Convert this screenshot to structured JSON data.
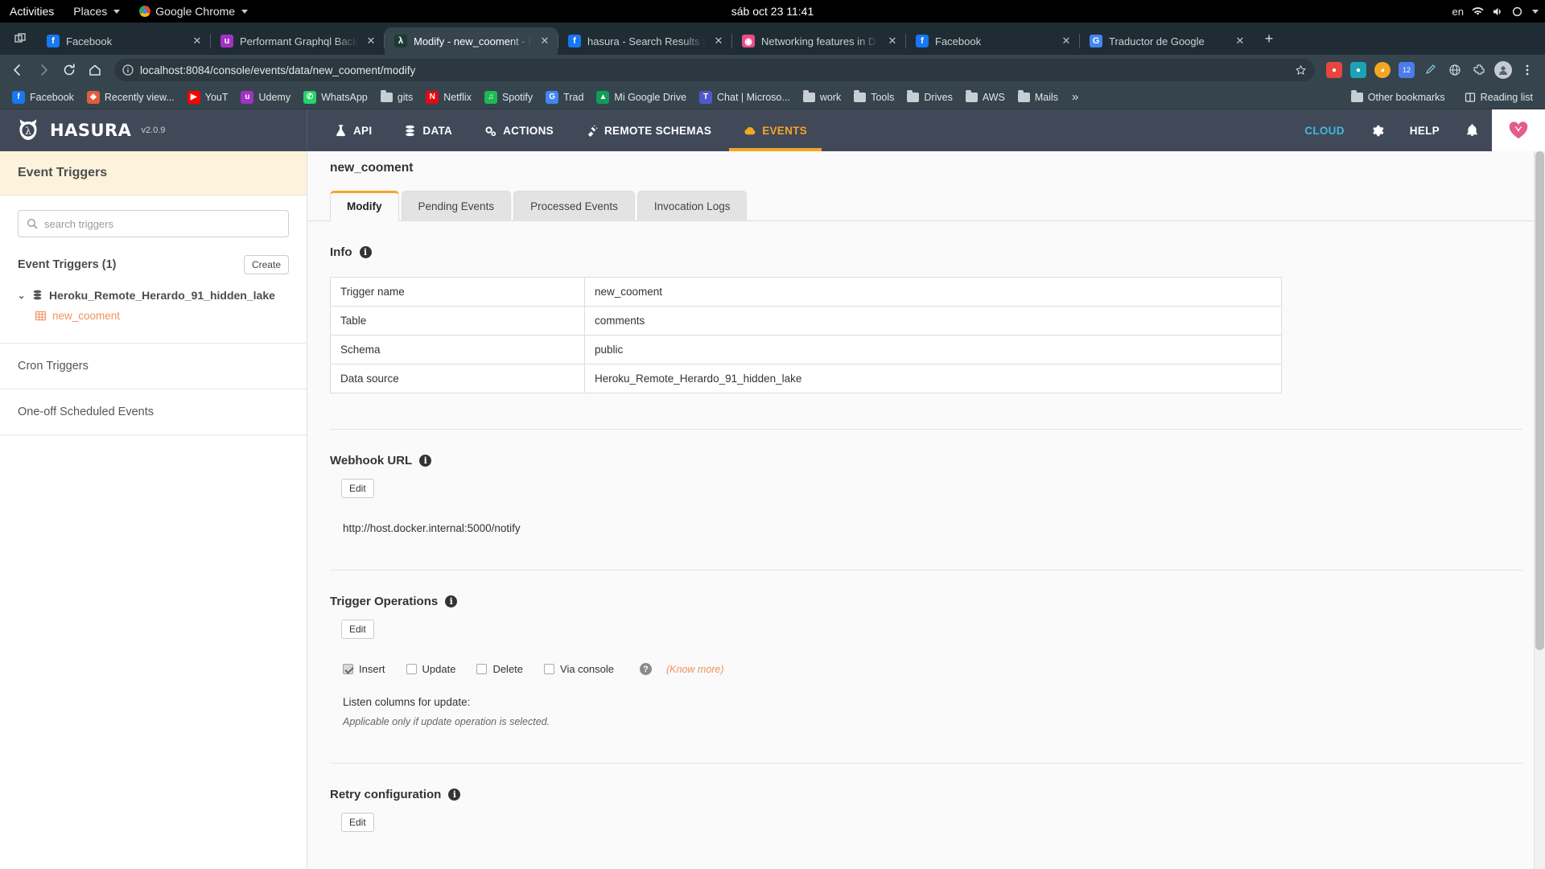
{
  "os_bar": {
    "activities": "Activities",
    "places": "Places",
    "app_name": "Google Chrome",
    "clock": "sáb oct 23  11:41",
    "lang": "en"
  },
  "browser": {
    "tabs": [
      {
        "title": "Facebook",
        "favicon": "facebook-icon",
        "color": "#1877f2",
        "glyph": "f",
        "active": false
      },
      {
        "title": "Performant Graphql Back",
        "favicon": "ubuntu-icon",
        "color": "#a232c4",
        "glyph": "u",
        "active": false
      },
      {
        "title": "Modify - new_cooment - E",
        "favicon": "hasura-icon",
        "color": "#1e3a34",
        "glyph": "λ",
        "active": true
      },
      {
        "title": "hasura - Search Results | F",
        "favicon": "facebook-icon",
        "color": "#1877f2",
        "glyph": "f",
        "active": false
      },
      {
        "title": "Networking features in D",
        "favicon": "docker-icon",
        "color": "#ea4c89",
        "glyph": "◉",
        "active": false
      },
      {
        "title": "Facebook",
        "favicon": "facebook-icon",
        "color": "#1877f2",
        "glyph": "f",
        "active": false
      },
      {
        "title": "Traductor de Google",
        "favicon": "google-translate-icon",
        "color": "#4285f4",
        "glyph": "G",
        "active": false
      }
    ],
    "new_tab_label": "+",
    "url": "localhost:8084/console/events/data/new_cooment/modify",
    "url_secure_icon": "info-circle-icon",
    "extension_badge_count": "12",
    "bookmarks": [
      {
        "label": "Facebook",
        "icon": "facebook-icon",
        "color": "#1877f2",
        "glyph": "f",
        "type": "site"
      },
      {
        "label": "Recently view...",
        "icon": "figma-icon",
        "color": "#e25c3b",
        "glyph": "◆",
        "type": "site"
      },
      {
        "label": "YouT",
        "icon": "youtube-icon",
        "color": "#ff0000",
        "glyph": "▶",
        "type": "site"
      },
      {
        "label": "Udemy",
        "icon": "udemy-icon",
        "color": "#a232c4",
        "glyph": "u",
        "type": "site"
      },
      {
        "label": "WhatsApp",
        "icon": "whatsapp-icon",
        "color": "#25d366",
        "glyph": "✆",
        "type": "site"
      },
      {
        "label": "gits",
        "icon": "folder-icon",
        "type": "folder"
      },
      {
        "label": "Netflix",
        "icon": "netflix-icon",
        "color": "#e50914",
        "glyph": "N",
        "type": "site"
      },
      {
        "label": "Spotify",
        "icon": "spotify-icon",
        "color": "#1db954",
        "glyph": "♫",
        "type": "site"
      },
      {
        "label": "Trad",
        "icon": "google-translate-icon",
        "color": "#4285f4",
        "glyph": "G",
        "type": "site"
      },
      {
        "label": "Mi Google Drive",
        "icon": "google-drive-icon",
        "color": "#0f9d58",
        "glyph": "▲",
        "type": "site"
      },
      {
        "label": "Chat | Microso...",
        "icon": "microsoft-teams-icon",
        "color": "#5059c9",
        "glyph": "T",
        "type": "site"
      },
      {
        "label": "work",
        "icon": "folder-icon",
        "type": "folder"
      },
      {
        "label": "Tools",
        "icon": "folder-icon",
        "type": "folder"
      },
      {
        "label": "Drives",
        "icon": "folder-icon",
        "type": "folder"
      },
      {
        "label": "AWS",
        "icon": "folder-icon",
        "type": "folder"
      },
      {
        "label": "Mails",
        "icon": "folder-icon",
        "type": "folder"
      }
    ],
    "bookmarks_overflow": "»",
    "other_bookmarks": "Other bookmarks",
    "reading_list": "Reading list"
  },
  "hasura": {
    "brand": "HASURA",
    "version": "v2.0.9",
    "nav": [
      {
        "label": "API",
        "icon": "flask-icon",
        "active": false
      },
      {
        "label": "DATA",
        "icon": "database-icon",
        "active": false
      },
      {
        "label": "ACTIONS",
        "icon": "gears-icon",
        "active": false
      },
      {
        "label": "REMOTE SCHEMAS",
        "icon": "plug-icon",
        "active": false
      },
      {
        "label": "EVENTS",
        "icon": "cloud-icon",
        "active": true
      }
    ],
    "right_nav": [
      {
        "label": "CLOUD",
        "kind": "cloud"
      },
      {
        "label": "",
        "kind": "gear-icon"
      },
      {
        "label": "HELP",
        "kind": "text"
      },
      {
        "label": "",
        "kind": "bell-icon"
      }
    ],
    "pro_badge": "heart-icon"
  },
  "sidebar": {
    "header": "Event Triggers",
    "search_placeholder": "search triggers",
    "search_icon": "search-icon",
    "section_title": "Event Triggers (1)",
    "create_label": "Create",
    "source": "Heroku_Remote_Herardo_91_hidden_lake",
    "trigger": "new_cooment",
    "cron_triggers": "Cron Triggers",
    "one_off": "One-off Scheduled Events"
  },
  "main": {
    "page_title": "new_cooment",
    "tabs": [
      {
        "label": "Modify",
        "active": true
      },
      {
        "label": "Pending Events",
        "active": false
      },
      {
        "label": "Processed Events",
        "active": false
      },
      {
        "label": "Invocation Logs",
        "active": false
      }
    ],
    "info": {
      "title": "Info",
      "rows": [
        {
          "key": "Trigger name",
          "value": "new_cooment"
        },
        {
          "key": "Table",
          "value": "comments"
        },
        {
          "key": "Schema",
          "value": "public"
        },
        {
          "key": "Data source",
          "value": "Heroku_Remote_Herardo_91_hidden_lake"
        }
      ]
    },
    "webhook": {
      "title": "Webhook URL",
      "edit_label": "Edit",
      "value": "http://host.docker.internal:5000/notify"
    },
    "operations": {
      "title": "Trigger Operations",
      "edit_label": "Edit",
      "checkboxes": [
        {
          "label": "Insert",
          "checked": true
        },
        {
          "label": "Update",
          "checked": false
        },
        {
          "label": "Delete",
          "checked": false
        },
        {
          "label": "Via console",
          "checked": false
        }
      ],
      "help_icon": "question-icon",
      "know_more": "(Know more)",
      "listen_label": "Listen columns for update:",
      "listen_note": "Applicable only if update operation is selected."
    },
    "retry": {
      "title": "Retry configuration",
      "edit_label": "Edit"
    }
  },
  "colors": {
    "hasura_header": "#414959",
    "accent_orange": "#f5a623",
    "trigger_orange": "#f0915a",
    "sidebar_header_bg": "#fdf3dd",
    "cloud_blue": "#3fb9e0"
  }
}
